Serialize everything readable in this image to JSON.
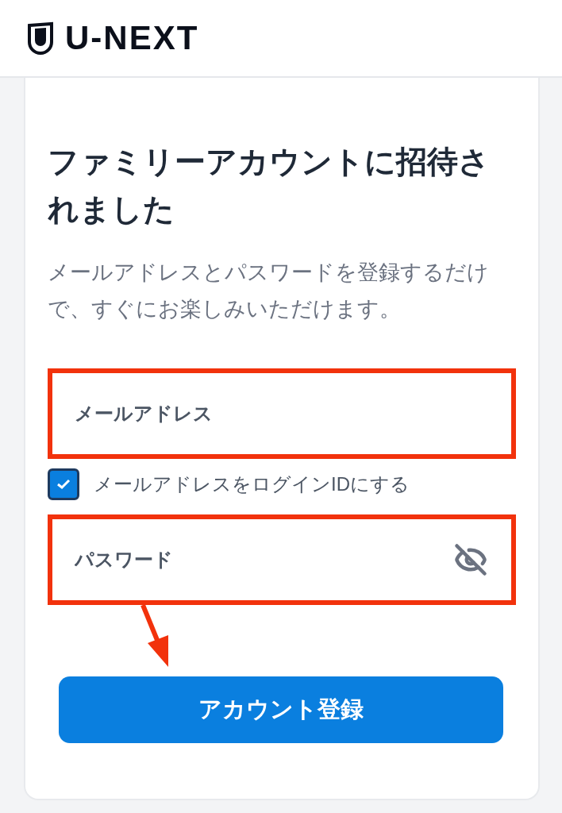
{
  "header": {
    "logo": "U-NEXT"
  },
  "card": {
    "title": "ファミリーアカウントに招待されました",
    "description": "メールアドレスとパスワードを登録するだけで、すぐにお楽しみいただけます。",
    "fields": [
      {
        "kind": "email",
        "placeholder": "メールアドレス",
        "highlighted": true
      },
      {
        "kind": "password",
        "placeholder": "パスワード",
        "highlighted": true
      }
    ],
    "login_id_checkbox": {
      "label": "メールアドレスをログインIDにする",
      "checked": true
    },
    "submit_button": "アカウント登録"
  }
}
